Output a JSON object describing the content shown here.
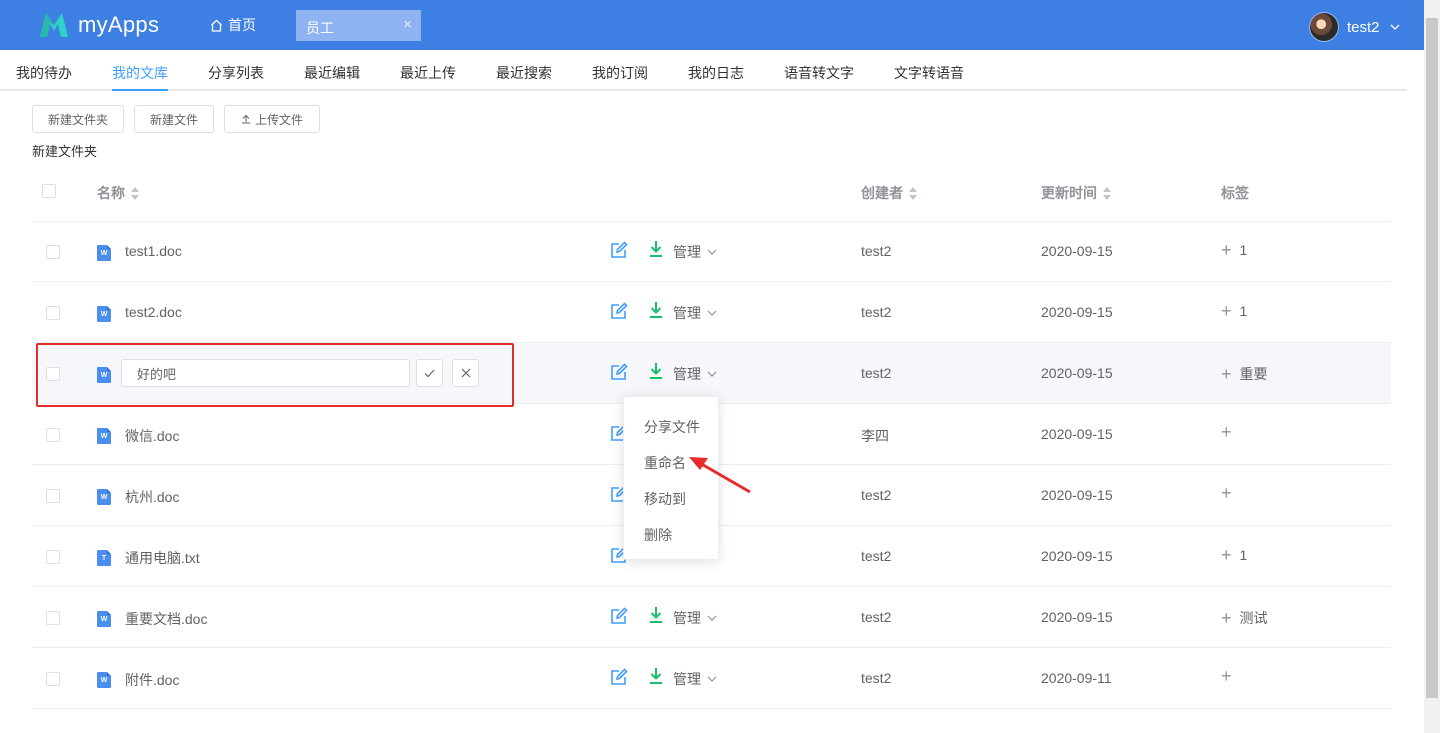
{
  "app": {
    "name": "myApps",
    "brand_color": "#3d7fe3",
    "accent_color": "#409eff"
  },
  "header": {
    "home_tab": "首页",
    "open_tab": "员工",
    "open_tab_close": "×",
    "user_name": "test2"
  },
  "nav": {
    "items": [
      "我的待办",
      "我的文库",
      "分享列表",
      "最近编辑",
      "最近上传",
      "最近搜索",
      "我的订阅",
      "我的日志",
      "语音转文字",
      "文字转语音"
    ],
    "active_index": 1
  },
  "toolbar": {
    "new_folder": "新建文件夹",
    "new_file": "新建文件",
    "upload_file": "上传文件"
  },
  "breadcrumb": "新建文件夹",
  "table": {
    "columns": {
      "name": "名称",
      "creator": "创建者",
      "updated": "更新时间",
      "tags": "标签"
    },
    "manage_label": "管理",
    "rows": [
      {
        "type": "W",
        "name": "test1.doc",
        "creator": "test2",
        "updated": "2020-09-15",
        "tag": "1"
      },
      {
        "type": "W",
        "name": "test2.doc",
        "creator": "test2",
        "updated": "2020-09-15",
        "tag": "1"
      },
      {
        "type": "W",
        "name": "",
        "rename_value": "好的吧",
        "creator": "test2",
        "updated": "2020-09-15",
        "tag": "重要"
      },
      {
        "type": "W",
        "name": "微信.doc",
        "creator": "李四",
        "updated": "2020-09-15",
        "tag": ""
      },
      {
        "type": "W",
        "name": "杭州.doc",
        "creator": "test2",
        "updated": "2020-09-15",
        "tag": ""
      },
      {
        "type": "T",
        "name": "通用电脑.txt",
        "creator": "test2",
        "updated": "2020-09-15",
        "tag": "1"
      },
      {
        "type": "W",
        "name": "重要文档.doc",
        "creator": "test2",
        "updated": "2020-09-15",
        "tag": "测试"
      },
      {
        "type": "W",
        "name": "附件.doc",
        "creator": "test2",
        "updated": "2020-09-11",
        "tag": ""
      }
    ]
  },
  "dropdown": {
    "items": [
      "分享文件",
      "重命名",
      "移动到",
      "删除"
    ]
  },
  "icons": {
    "logo": "myapps-logo-icon",
    "home": "home-icon",
    "edit": "edit-icon",
    "download": "download-icon",
    "confirm": "check-icon",
    "cancel": "close-icon"
  },
  "colors": {
    "download": "#19be6b",
    "highlight_box": "#e62b2b"
  }
}
